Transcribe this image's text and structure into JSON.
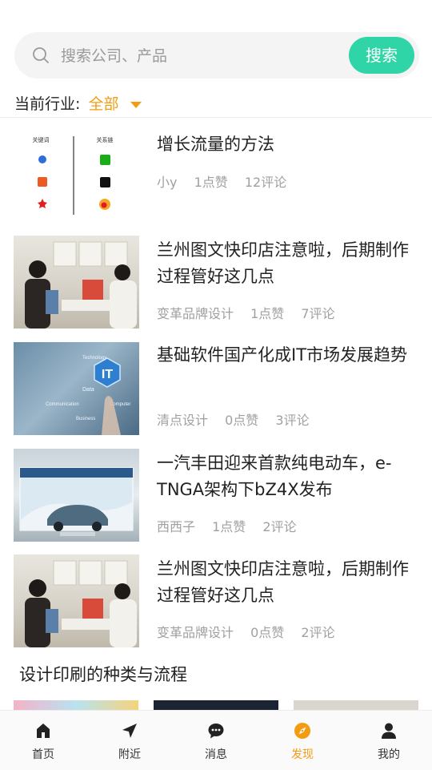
{
  "search": {
    "placeholder": "搜索公司、产品",
    "button": "搜索"
  },
  "industry": {
    "label": "当前行业:",
    "value": "全部"
  },
  "articles": [
    {
      "title": "增长流量的方法",
      "author": "小y",
      "likes": "1点赞",
      "comments": "12评论",
      "thumb_texts": {
        "left_heading": "关键词",
        "right_heading": "关系链"
      }
    },
    {
      "title": "兰州图文快印店注意啦，后期制作过程管好这几点",
      "author": "变革品牌设计",
      "likes": "1点赞",
      "comments": "7评论"
    },
    {
      "title": "基础软件国产化成IT市场发展趋势",
      "author": "清点设计",
      "likes": "0点赞",
      "comments": "3评论",
      "thumb_texts": {
        "badge": "IT",
        "w1": "Data",
        "w2": "Communication",
        "w3": "Business",
        "w4": "Technology",
        "w5": "Computer"
      }
    },
    {
      "title": "一汽丰田迎来首款纯电动车，e-TNGA架构下bZ4X发布",
      "author": "西西子",
      "likes": "1点赞",
      "comments": "2评论"
    },
    {
      "title": "兰州图文快印店注意啦，后期制作过程管好这几点",
      "author": "变革品牌设计",
      "likes": "0点赞",
      "comments": "2评论"
    }
  ],
  "section": {
    "title": "设计印刷的种类与流程"
  },
  "tabs": [
    {
      "label": "首页",
      "icon": "home-icon"
    },
    {
      "label": "附近",
      "icon": "navigation-arrow-icon"
    },
    {
      "label": "消息",
      "icon": "chat-bubble-icon"
    },
    {
      "label": "发现",
      "icon": "compass-icon",
      "active": true
    },
    {
      "label": "我的",
      "icon": "user-icon"
    }
  ],
  "colors": {
    "accent_green": "#2fd5a7",
    "accent_orange": "#f39c12",
    "meta_gray": "#a0a0a0"
  }
}
